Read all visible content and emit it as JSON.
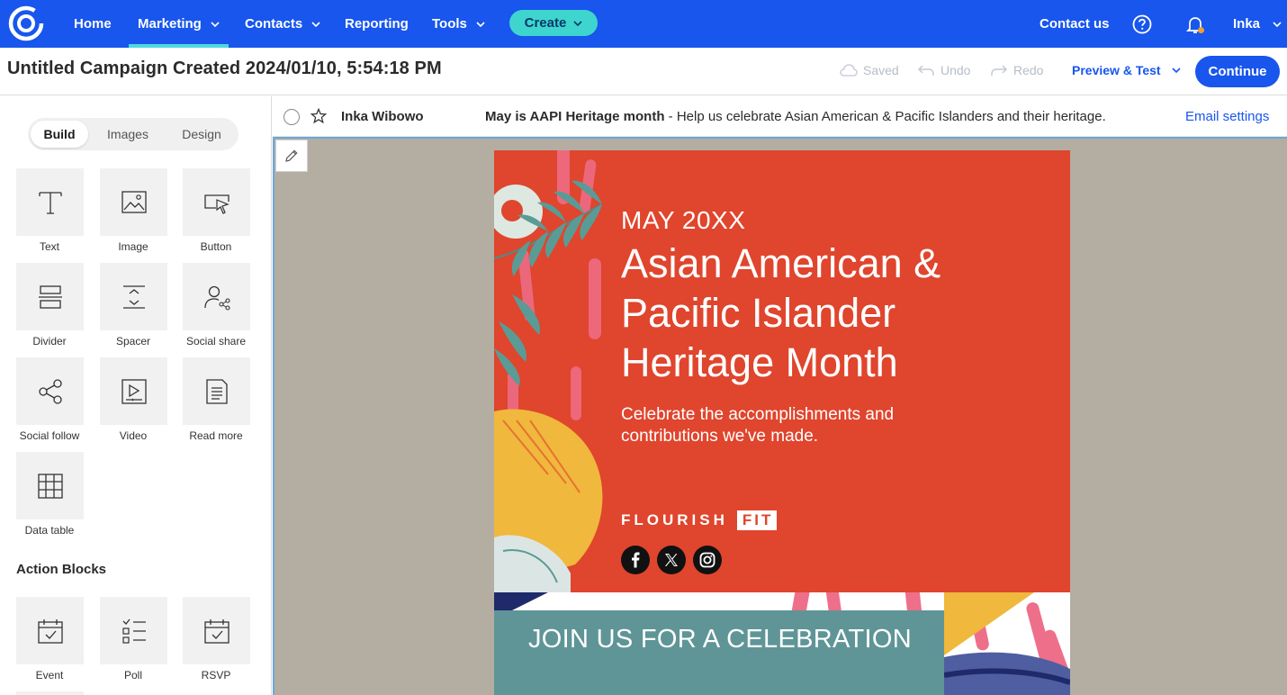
{
  "nav": {
    "items": [
      "Home",
      "Marketing",
      "Contacts",
      "Reporting",
      "Tools"
    ],
    "active": "Marketing",
    "create_label": "Create",
    "contact_us": "Contact us",
    "user": "Inka"
  },
  "titlebar": {
    "title": "Untitled Campaign Created 2024/01/10, 5:54:18 PM",
    "saved": "Saved",
    "undo": "Undo",
    "redo": "Redo",
    "preview": "Preview & Test",
    "continue": "Continue"
  },
  "sidebar": {
    "tabs": [
      "Build",
      "Images",
      "Design"
    ],
    "active_tab": "Build",
    "blocks": [
      "Text",
      "Image",
      "Button",
      "Divider",
      "Spacer",
      "Social share",
      "Social follow",
      "Video",
      "Read more",
      "Data table"
    ],
    "action_title": "Action Blocks",
    "action_blocks": [
      "Event",
      "Poll",
      "RSVP"
    ]
  },
  "subject": {
    "sender": "Inka Wibowo",
    "subject_bold": "May is AAPI Heritage month",
    "subject_rest": " - Help us celebrate Asian American & Pacific Islanders and their heritage.",
    "settings": "Email settings"
  },
  "email": {
    "eyebrow": "MAY 20XX",
    "title": "Asian American & Pacific Islander Heritage Month",
    "subtitle": "Celebrate the accomplishments and contributions we've made.",
    "brand_left": "FLOURISH",
    "brand_right": "FIT",
    "join": "JOIN US FOR A CELEBRATION"
  },
  "colors": {
    "brand_blue": "#1856ed",
    "create_teal": "#3ed5cf",
    "hero_red": "#e0452d",
    "canvas_bg": "#b4ada2",
    "join_teal": "#5f9596"
  }
}
